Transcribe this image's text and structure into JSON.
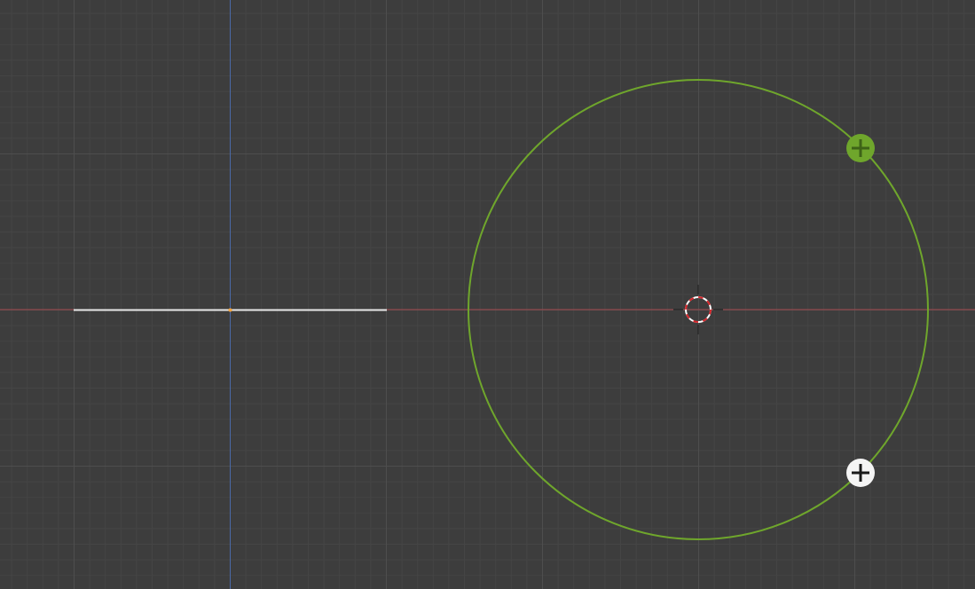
{
  "viewport": {
    "background_color": "#3d3d3d",
    "minor_grid_color": "#454545",
    "major_grid_color": "#4e4e4e",
    "x_axis_color": "#a3484d",
    "y_axis_color": "#4a6aa8"
  },
  "scene": {
    "selected_line": {
      "color": "#e8e8e8",
      "origin_color": "#f3a33c"
    },
    "circle": {
      "color": "#6fa62c"
    },
    "cursor_3d": {
      "ring_color_a": "#ffffff",
      "ring_color_b": "#d8262b"
    }
  },
  "gizmos": {
    "add_active": {
      "icon": "plus-icon",
      "fill_color": "#6fa62c",
      "glyph_color": "#3e6317"
    },
    "add_inactive": {
      "icon": "plus-icon",
      "fill_color": "#f4f4f4",
      "glyph_color": "#1a1a1a"
    }
  }
}
